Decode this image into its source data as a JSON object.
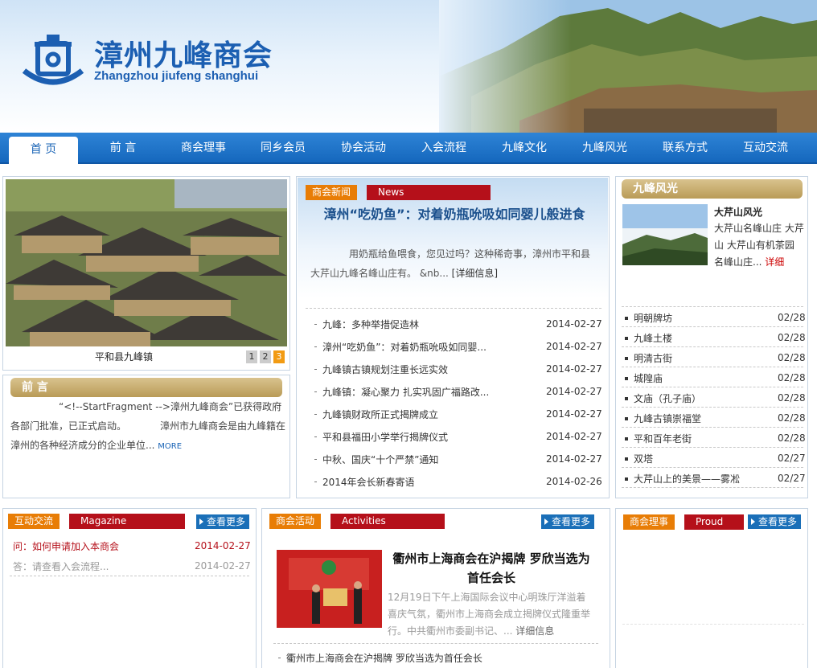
{
  "brand": {
    "cn": "漳州九峰商会",
    "en": "Zhangzhou jiufeng shanghui"
  },
  "nav": [
    "首 页",
    "前 言",
    "商会理事",
    "同乡会员",
    "协会活动",
    "入会流程",
    "九峰文化",
    "九峰风光",
    "联系方式",
    "互动交流"
  ],
  "slideshow": {
    "caption": "平和县九峰镇",
    "pages": [
      "1",
      "2",
      "3"
    ]
  },
  "preface": {
    "title": "前 言",
    "text": "“<!--StartFragment -->漳州九峰商会”已获得政府各部门批准，已正式启动。　　　　漳州市九峰商会是由九峰籍在漳州的各种经济成分的企业单位...",
    "more": "MORE"
  },
  "news": {
    "tag_cn": "商会新闻",
    "tag_en": "News",
    "headline": "漳州“吃奶鱼”：对着奶瓶吮吸如同婴儿般进食",
    "summary": "用奶瓶给鱼喂食，您见过吗？这种稀奇事，漳州市平和县大芹山九峰名峰山庄有。 &nb...",
    "detail": "[详细信息]",
    "items": [
      {
        "title": "九峰：多种举措促造林",
        "date": "2014-02-27"
      },
      {
        "title": "漳州“吃奶鱼”：对着奶瓶吮吸如同婴...",
        "date": "2014-02-27"
      },
      {
        "title": "九峰镇古镇规划注重长远实效",
        "date": "2014-02-27"
      },
      {
        "title": "九峰镇：凝心聚力 扎实巩固广福路改...",
        "date": "2014-02-27"
      },
      {
        "title": "九峰镇财政所正式揭牌成立",
        "date": "2014-02-27"
      },
      {
        "title": "平和县福田小学举行揭牌仪式",
        "date": "2014-02-27"
      },
      {
        "title": "中秋、国庆“十个严禁”通知",
        "date": "2014-02-27"
      },
      {
        "title": "2014年会长新春寄语",
        "date": "2014-02-26"
      }
    ]
  },
  "scenery": {
    "title": "九峰风光",
    "feature_title": "大芹山风光",
    "feature_text": "大芹山名峰山庄 大芹山 大芹山有机茶园 名峰山庄...",
    "detail": "详细",
    "items": [
      {
        "title": "明朝牌坊",
        "date": "02/28"
      },
      {
        "title": "九峰土楼",
        "date": "02/28"
      },
      {
        "title": "明清古街",
        "date": "02/28"
      },
      {
        "title": "城隍庙",
        "date": "02/28"
      },
      {
        "title": "文庙（孔子庙）",
        "date": "02/28"
      },
      {
        "title": "九峰古镇崇福堂",
        "date": "02/28"
      },
      {
        "title": "平和百年老街",
        "date": "02/28"
      },
      {
        "title": "双塔",
        "date": "02/27"
      },
      {
        "title": "大芹山上的美景——雾凇",
        "date": "02/27"
      }
    ]
  },
  "interact": {
    "tag_cn": "互动交流",
    "tag_en": "Magazine",
    "more": "查看更多",
    "question": "问：如何申请加入本商会",
    "q_date": "2014-02-27",
    "answer": "答：请查看入会流程...",
    "a_date": "2014-02-27"
  },
  "activities": {
    "tag_cn": "商会活动",
    "tag_en": "Activities",
    "more": "查看更多",
    "headline": "衢州市上海商会在沪揭牌 罗欣当选为首任会长",
    "summary": "12月19日下午上海国际会议中心明珠厅洋溢着喜庆气氛，衢州市上海商会成立揭牌仪式隆重举行。中共衢州市委副书记、...",
    "detail": "详细信息",
    "items": [
      "衢州市上海商会在沪揭牌 罗欣当选为首任会长"
    ]
  },
  "council": {
    "tag_cn": "商会理事",
    "tag_en": "Proud",
    "more": "查看更多"
  }
}
